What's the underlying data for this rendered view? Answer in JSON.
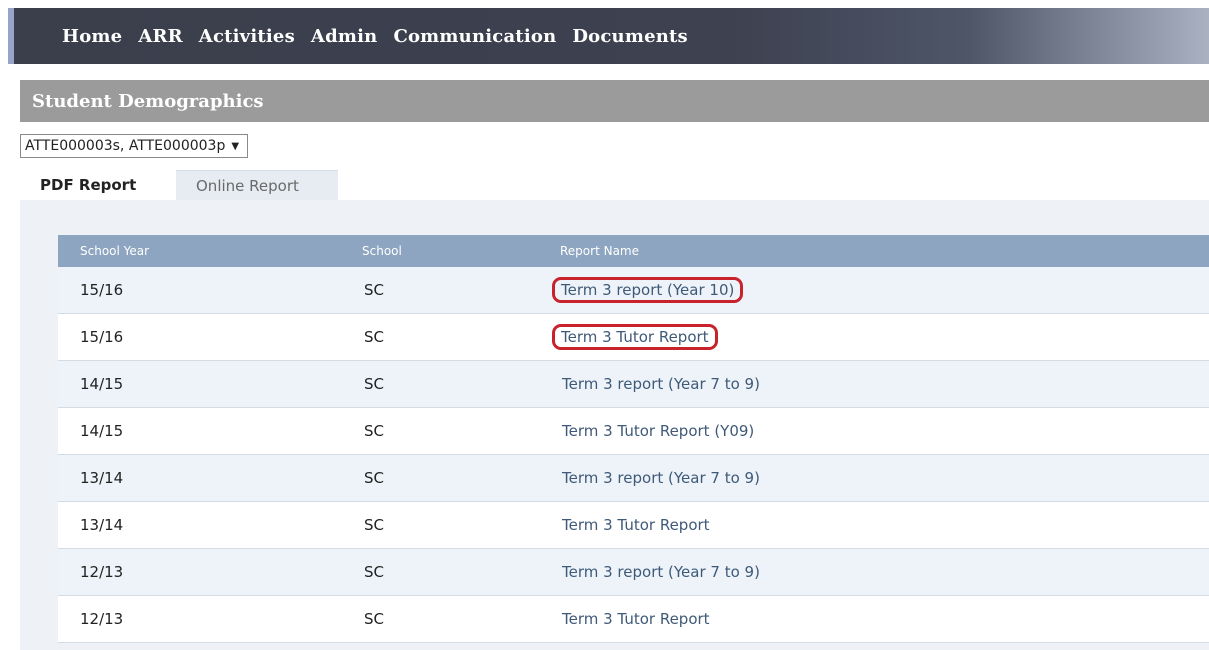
{
  "nav": {
    "items": [
      "Home",
      "ARR",
      "Activities",
      "Admin",
      "Communication",
      "Documents"
    ]
  },
  "section": {
    "title": "Student Demographics"
  },
  "student_select": {
    "selected": "ATTE000003s, ATTE000003p",
    "arrow": "▼"
  },
  "tabs": [
    {
      "label": "PDF Report",
      "active": true
    },
    {
      "label": "Online Report",
      "active": false
    }
  ],
  "table": {
    "columns": [
      "School Year",
      "School",
      "Report Name"
    ],
    "rows": [
      {
        "year": "15/16",
        "school": "SC",
        "report": "Term 3 report (Year 10)"
      },
      {
        "year": "15/16",
        "school": "SC",
        "report": "Term 3 Tutor Report"
      },
      {
        "year": "14/15",
        "school": "SC",
        "report": "Term 3 report (Year 7 to 9)"
      },
      {
        "year": "14/15",
        "school": "SC",
        "report": "Term 3 Tutor Report (Y09)"
      },
      {
        "year": "13/14",
        "school": "SC",
        "report": "Term 3 report (Year 7 to 9)"
      },
      {
        "year": "13/14",
        "school": "SC",
        "report": "Term 3 Tutor Report"
      },
      {
        "year": "12/13",
        "school": "SC",
        "report": "Term 3 report (Year 7 to 9)"
      },
      {
        "year": "12/13",
        "school": "SC",
        "report": "Term 3 Tutor Report"
      }
    ]
  },
  "colors": {
    "nav_bg": "#3b3f4c",
    "header_bg": "#9b9b9b",
    "table_header_bg": "#8da5c0",
    "link": "#3f5a78",
    "annotation": "#c8232c"
  }
}
